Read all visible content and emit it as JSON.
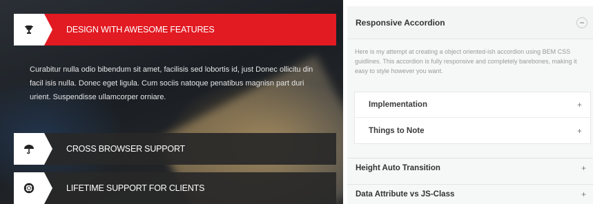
{
  "left_accordion": {
    "items": [
      {
        "label": "DESIGN WITH AWESOME FEATURES",
        "icon": "trophy-icon"
      },
      {
        "label": "CROSS BROWSER SUPPORT",
        "icon": "umbrella-icon"
      },
      {
        "label": "LIFETIME SUPPORT FOR CLIENTS",
        "icon": "lifebuoy-icon"
      }
    ],
    "active_body": "Curabitur nulla odio bibendum sit amet, facilisis sed lobortis id, just Donec ollicitu din facil isis nulla.  Donec eget ligula. Cum sociis natoque penatibus magnisn part duri urient. Suspendisse ullamcorper orniare.",
    "accent": "#e21a22"
  },
  "right_accordion": {
    "title": "Responsive Accordion",
    "toggle": "−",
    "description": "Here is my attempt at creating a object oriented-ish accordion using BEM CSS guidlines. This accordion is fully responsive and completely barebones, making it easy to style however you want.",
    "inner_items": [
      {
        "label": "Implementation",
        "toggle": "+"
      },
      {
        "label": "Things to Note",
        "toggle": "+"
      }
    ],
    "outer_items": [
      {
        "label": "Height Auto Transition",
        "toggle": "+"
      },
      {
        "label": "Data Attribute vs JS-Class",
        "toggle": "+"
      }
    ]
  }
}
